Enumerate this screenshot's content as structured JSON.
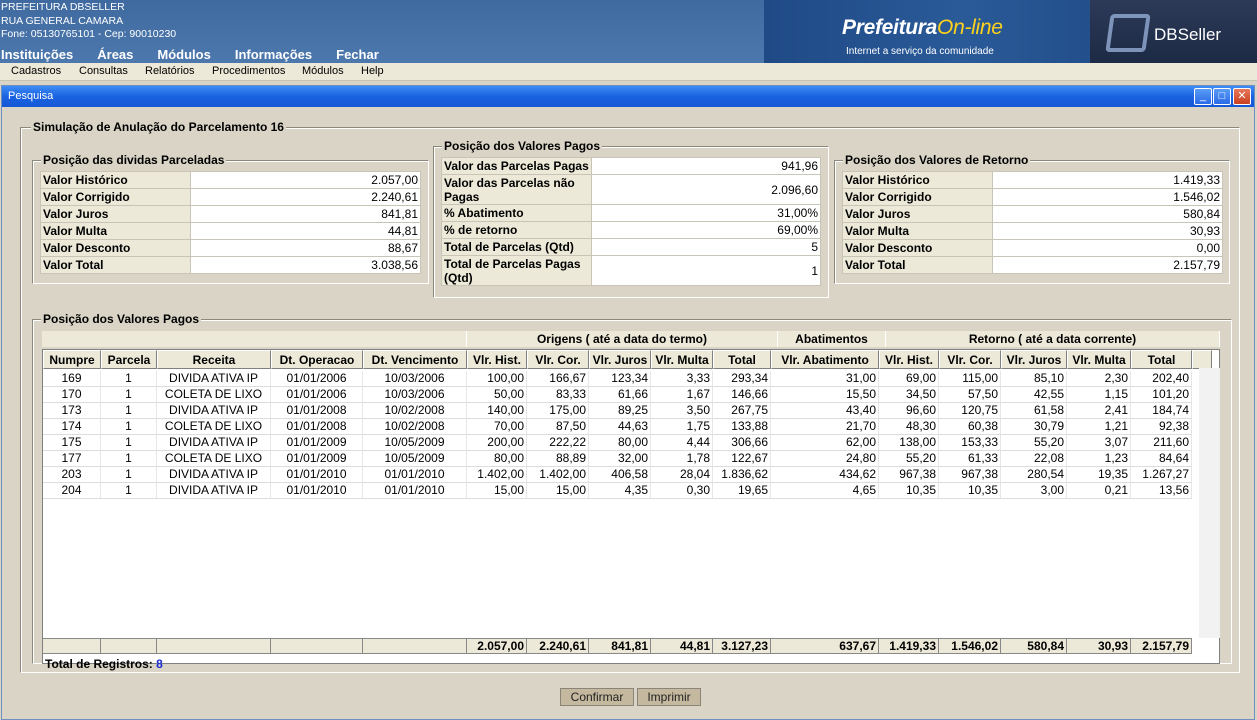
{
  "header": {
    "org": "PREFEITURA DBSELLER",
    "address": "RUA GENERAL CAMARA",
    "phone": "Fone: 05130765101  -  Cep: 90010230",
    "menu": [
      "Instituições",
      "Áreas",
      "Módulos",
      "Informações",
      "Fechar"
    ],
    "banner_title": "Prefeitura",
    "banner_title2": "On-line",
    "banner_sub": "Internet a serviço da comunidade",
    "brand": "DBSeller"
  },
  "menubar": [
    "Cadastros",
    "Consultas",
    "Relatórios",
    "Procedimentos",
    "Módulos",
    "Help"
  ],
  "window": {
    "title": "Pesquisa",
    "section_title": "Simulação de Anulação do Parcelamento 16"
  },
  "dividas": {
    "legend": "Posição das dividas Parceladas",
    "rows": [
      {
        "k": "Valor Histórico",
        "v": "2.057,00"
      },
      {
        "k": "Valor Corrigido",
        "v": "2.240,61"
      },
      {
        "k": "Valor Juros",
        "v": "841,81"
      },
      {
        "k": "Valor Multa",
        "v": "44,81"
      },
      {
        "k": "Valor Desconto",
        "v": "88,67"
      },
      {
        "k": "Valor Total",
        "v": "3.038,56"
      }
    ]
  },
  "pagos": {
    "legend": "Posição dos Valores Pagos",
    "rows": [
      {
        "k": "Valor das Parcelas Pagas",
        "v": "941,96"
      },
      {
        "k": "Valor das Parcelas não Pagas",
        "v": "2.096,60"
      },
      {
        "k": "% Abatimento",
        "v": "31,00%"
      },
      {
        "k": "% de retorno",
        "v": "69,00%"
      },
      {
        "k": "Total de Parcelas (Qtd)",
        "v": "5"
      },
      {
        "k": "Total de Parcelas Pagas (Qtd)",
        "v": "1"
      }
    ]
  },
  "retorno": {
    "legend": "Posição dos Valores de Retorno",
    "rows": [
      {
        "k": "Valor Histórico",
        "v": "1.419,33"
      },
      {
        "k": "Valor Corrigido",
        "v": "1.546,02"
      },
      {
        "k": "Valor Juros",
        "v": "580,84"
      },
      {
        "k": "Valor Multa",
        "v": "30,93"
      },
      {
        "k": "Valor Desconto",
        "v": "0,00"
      },
      {
        "k": "Valor Total",
        "v": "2.157,79"
      }
    ]
  },
  "grid": {
    "legend": "Posição dos Valores Pagos",
    "groups": {
      "origens": "Origens ( até a data do termo)",
      "abat": "Abatimentos",
      "retorno": "Retorno ( até a data corrente)"
    },
    "columns": [
      "Numpre",
      "Parcela",
      "Receita",
      "Dt. Operacao",
      "Dt. Vencimento",
      "Vlr. Hist.",
      "Vlr. Cor.",
      "Vlr. Juros",
      "Vlr. Multa",
      "Total",
      "Vlr. Abatimento",
      "Vlr. Hist.",
      "Vlr. Cor.",
      "Vlr. Juros",
      "Vlr. Multa",
      "Total"
    ],
    "rows": [
      [
        "169",
        "1",
        "DIVIDA ATIVA IP",
        "01/01/2006",
        "10/03/2006",
        "100,00",
        "166,67",
        "123,34",
        "3,33",
        "293,34",
        "31,00",
        "69,00",
        "115,00",
        "85,10",
        "2,30",
        "202,40"
      ],
      [
        "170",
        "1",
        "COLETA DE LIXO",
        "01/01/2006",
        "10/03/2006",
        "50,00",
        "83,33",
        "61,66",
        "1,67",
        "146,66",
        "15,50",
        "34,50",
        "57,50",
        "42,55",
        "1,15",
        "101,20"
      ],
      [
        "173",
        "1",
        "DIVIDA ATIVA IP",
        "01/01/2008",
        "10/02/2008",
        "140,00",
        "175,00",
        "89,25",
        "3,50",
        "267,75",
        "43,40",
        "96,60",
        "120,75",
        "61,58",
        "2,41",
        "184,74"
      ],
      [
        "174",
        "1",
        "COLETA DE LIXO",
        "01/01/2008",
        "10/02/2008",
        "70,00",
        "87,50",
        "44,63",
        "1,75",
        "133,88",
        "21,70",
        "48,30",
        "60,38",
        "30,79",
        "1,21",
        "92,38"
      ],
      [
        "175",
        "1",
        "DIVIDA ATIVA IP",
        "01/01/2009",
        "10/05/2009",
        "200,00",
        "222,22",
        "80,00",
        "4,44",
        "306,66",
        "62,00",
        "138,00",
        "153,33",
        "55,20",
        "3,07",
        "211,60"
      ],
      [
        "177",
        "1",
        "COLETA DE LIXO",
        "01/01/2009",
        "10/05/2009",
        "80,00",
        "88,89",
        "32,00",
        "1,78",
        "122,67",
        "24,80",
        "55,20",
        "61,33",
        "22,08",
        "1,23",
        "84,64"
      ],
      [
        "203",
        "1",
        "DIVIDA ATIVA IP",
        "01/01/2010",
        "01/01/2010",
        "1.402,00",
        "1.402,00",
        "406,58",
        "28,04",
        "1.836,62",
        "434,62",
        "967,38",
        "967,38",
        "280,54",
        "19,35",
        "1.267,27"
      ],
      [
        "204",
        "1",
        "DIVIDA ATIVA IP",
        "01/01/2010",
        "01/01/2010",
        "15,00",
        "15,00",
        "4,35",
        "0,30",
        "19,65",
        "4,65",
        "10,35",
        "10,35",
        "3,00",
        "0,21",
        "13,56"
      ]
    ],
    "totals": [
      "",
      "",
      "",
      "",
      "",
      "2.057,00",
      "2.240,61",
      "841,81",
      "44,81",
      "3.127,23",
      "637,67",
      "1.419,33",
      "1.546,02",
      "580,84",
      "30,93",
      "2.157,79"
    ],
    "records_label": "Total de Registros:",
    "records_count": "8"
  },
  "buttons": {
    "confirm": "Confirmar",
    "print": "Imprimir"
  }
}
